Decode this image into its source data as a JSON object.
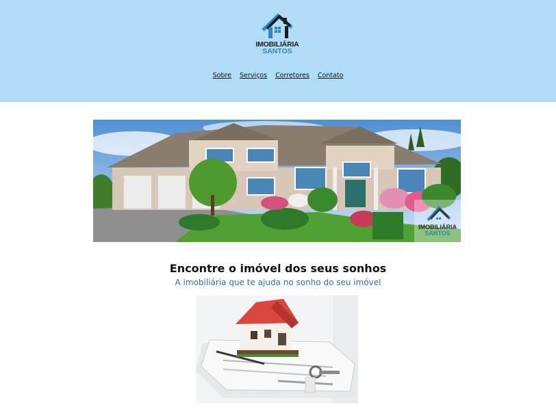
{
  "header": {
    "bg_color": "#b1dcf8",
    "logo": {
      "icon": "house-logo-icon",
      "line1": "IMOBILIÁRIA",
      "line2": "SANTOS"
    },
    "nav": [
      {
        "label": "Sobre"
      },
      {
        "label": "Serviços"
      },
      {
        "label": "Corretores"
      },
      {
        "label": "Contato"
      }
    ]
  },
  "hero": {
    "image": "suburban-house-photo",
    "watermark": {
      "line1": "IMOBILIÁRIA",
      "line2": "SANTOS"
    }
  },
  "main": {
    "headline": "Encontre o imóvel dos seus sonhos",
    "subheadline": "A imobiliária que te ajuda no sonho do seu imóvel",
    "image": "house-model-on-contract-photo"
  },
  "colors": {
    "accent": "#2f86c6",
    "subhead": "#2a75b0",
    "text": "#111111"
  }
}
